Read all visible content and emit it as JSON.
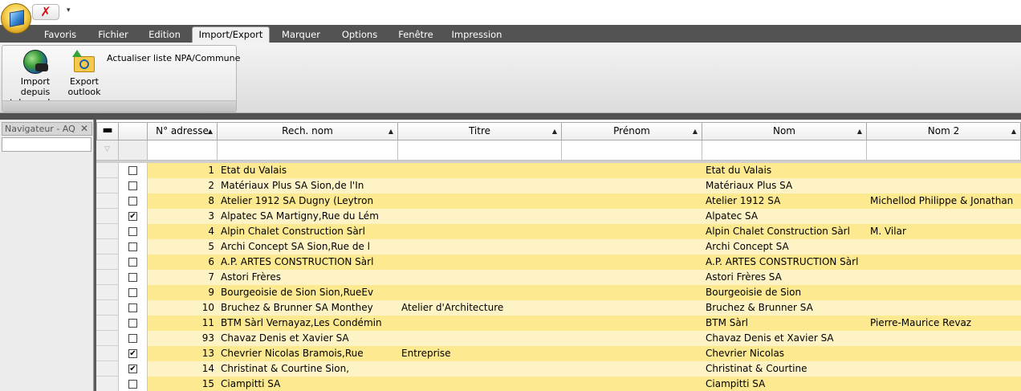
{
  "qat": {
    "close_glyph": "✗",
    "dropdown_glyph": "▾"
  },
  "tabs": [
    {
      "label": "Favoris",
      "active": false
    },
    {
      "label": "Fichier",
      "active": false
    },
    {
      "label": "Edition",
      "active": false
    },
    {
      "label": "Import/Export",
      "active": true
    },
    {
      "label": "Marquer",
      "active": false
    },
    {
      "label": "Options",
      "active": false
    },
    {
      "label": "Fenêtre",
      "active": false
    },
    {
      "label": "Impression",
      "active": false
    }
  ],
  "ribbon": {
    "import_label_1": "Import depuis",
    "import_label_2": "tel.search.c",
    "export_label_1": "Export",
    "export_label_2": "outlook",
    "npa_label": "Actualiser liste NPA/Commune"
  },
  "navigator": {
    "title": "Navigateur - AQ",
    "close": "✕",
    "search_value": ""
  },
  "grid": {
    "columns": [
      {
        "key": "num",
        "label": "N° adresse"
      },
      {
        "key": "rech",
        "label": "Rech. nom"
      },
      {
        "key": "titre",
        "label": "Titre"
      },
      {
        "key": "prenom",
        "label": "Prénom"
      },
      {
        "key": "nom",
        "label": "Nom"
      },
      {
        "key": "nom2",
        "label": "Nom 2"
      }
    ],
    "header_dash": "▬",
    "rows": [
      {
        "checked": false,
        "num": "1",
        "rech": "Etat du Valais",
        "titre": "",
        "prenom": "",
        "nom": "Etat du Valais",
        "nom2": ""
      },
      {
        "checked": false,
        "num": "2",
        "rech": "Matériaux Plus SA Sion,de l'In",
        "titre": "",
        "prenom": "",
        "nom": "Matériaux Plus SA",
        "nom2": ""
      },
      {
        "checked": false,
        "num": "8",
        "rech": "Atelier 1912 SA Dugny (Leytron",
        "titre": "",
        "prenom": "",
        "nom": "Atelier 1912 SA",
        "nom2": "Michellod Philippe & Jonathan"
      },
      {
        "checked": true,
        "num": "3",
        "rech": "Alpatec SA Martigny,Rue du Lém",
        "titre": "",
        "prenom": "",
        "nom": "Alpatec SA",
        "nom2": ""
      },
      {
        "checked": false,
        "num": "4",
        "rech": "Alpin Chalet Construction Sàrl",
        "titre": "",
        "prenom": "",
        "nom": "Alpin Chalet Construction Sàrl",
        "nom2": "M. Vilar"
      },
      {
        "checked": false,
        "num": "5",
        "rech": "Archi Concept SA Sion,Rue de l",
        "titre": "",
        "prenom": "",
        "nom": "Archi Concept SA",
        "nom2": ""
      },
      {
        "checked": false,
        "num": "6",
        "rech": "A.P. ARTES CONSTRUCTION Sàrl",
        "titre": "",
        "prenom": "",
        "nom": "A.P. ARTES CONSTRUCTION Sàrl",
        "nom2": ""
      },
      {
        "checked": false,
        "num": "7",
        "rech": "Astori Frères",
        "titre": "",
        "prenom": "",
        "nom": "Astori Frères SA",
        "nom2": ""
      },
      {
        "checked": false,
        "num": "9",
        "rech": "Bourgeoisie de Sion Sion,RueEv",
        "titre": "",
        "prenom": "",
        "nom": "Bourgeoisie de Sion",
        "nom2": ""
      },
      {
        "checked": false,
        "num": "10",
        "rech": "Bruchez & Brunner SA Monthey",
        "titre": "Atelier d'Architecture",
        "prenom": "",
        "nom": "Bruchez & Brunner SA",
        "nom2": ""
      },
      {
        "checked": false,
        "num": "11",
        "rech": "BTM Sàrl Vernayaz,Les Condémin",
        "titre": "",
        "prenom": "",
        "nom": "BTM Sàrl",
        "nom2": "Pierre-Maurice Revaz"
      },
      {
        "checked": false,
        "num": "93",
        "rech": "Chavaz Denis et Xavier SA",
        "titre": "",
        "prenom": "",
        "nom": "Chavaz Denis et Xavier SA",
        "nom2": ""
      },
      {
        "checked": true,
        "num": "13",
        "rech": "Chevrier Nicolas Bramois,Rue",
        "titre": "Entreprise",
        "prenom": "",
        "nom": "Chevrier Nicolas",
        "nom2": ""
      },
      {
        "checked": true,
        "num": "14",
        "rech": "Christinat & Courtine Sion,",
        "titre": "",
        "prenom": "",
        "nom": "Christinat & Courtine",
        "nom2": ""
      },
      {
        "checked": false,
        "num": "15",
        "rech": "Ciampitti SA",
        "titre": "",
        "prenom": "",
        "nom": "Ciampitti SA",
        "nom2": ""
      }
    ]
  }
}
